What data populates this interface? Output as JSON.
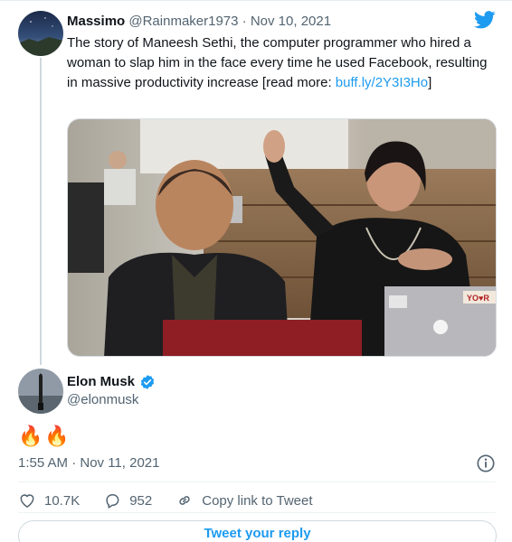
{
  "parent_tweet": {
    "author_name": "Massimo",
    "handle": "@Rainmaker1973",
    "separator": "·",
    "date": "Nov 10, 2021",
    "text": "The story of Maneesh Sethi, the computer programmer who hired a woman to slap him in the face every time he used Facebook, resulting in massive productivity increase [read more: ",
    "link": "buff.ly/2Y3I3Ho",
    "text_end": "]",
    "media_sticker": "YO♥R"
  },
  "main_tweet": {
    "author_name": "Elon Musk",
    "handle": "@elonmusk",
    "text": "🔥🔥",
    "timestamp": "1:55 AM · Nov 11, 2021"
  },
  "actions": {
    "likes": "10.7K",
    "replies": "952",
    "copy_link": "Copy link to Tweet"
  },
  "reply_button": "Tweet your reply",
  "colors": {
    "accent": "#1d9bf0",
    "muted": "#536471",
    "verified": "#1d9bf0"
  },
  "icons": [
    "twitter-bird-icon",
    "verified-badge-icon",
    "info-icon",
    "heart-icon",
    "reply-icon",
    "link-icon"
  ]
}
